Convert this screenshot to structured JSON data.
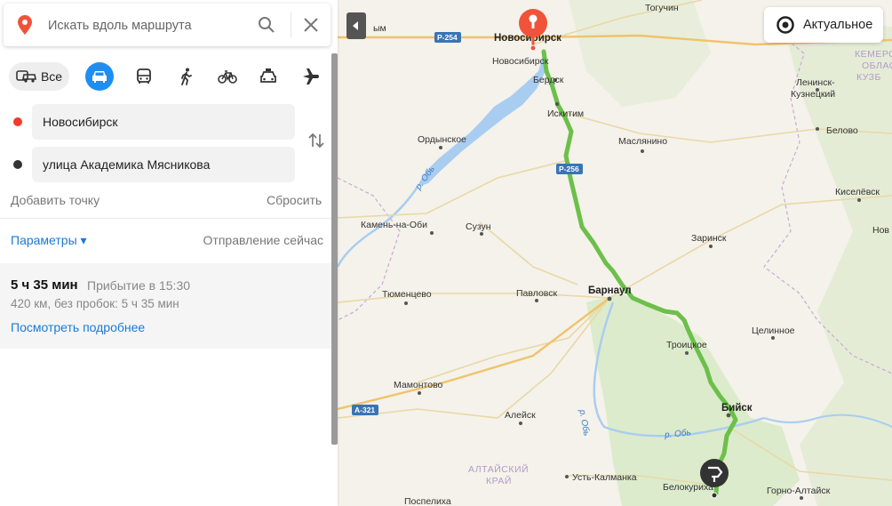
{
  "search": {
    "placeholder": "Искать вдоль маршрута"
  },
  "modes": {
    "all_label": "Все",
    "selected": "car"
  },
  "route_points": {
    "from": "Новосибирск",
    "to": "улица Академика Мясникова"
  },
  "actions": {
    "add_point": "Добавить точку",
    "reset": "Сбросить",
    "params": "Параметры ▾",
    "depart": "Отправление сейчас"
  },
  "route": {
    "duration": "5 ч 35 мин",
    "arrival": "Прибытие в 15:30",
    "distance": "420 км, без пробок: 5 ч 35 мин",
    "details_link": "Посмотреть подробнее"
  },
  "map": {
    "actual_button": "Актуальное",
    "start_city_marker": "Новосибирск",
    "cities": {
      "novosibirsk": "Новосибирск",
      "tyumentsevo_gap": "ым",
      "toguchin": "Тогучин",
      "berdsk": "Бердск",
      "iskitim": "Искитим",
      "ordynskoe": "Ордынское",
      "maslyanino": "Маслянино",
      "leninsk": "Ленинск-\nКузнецкий",
      "belovo": "Белово",
      "kiselevsk": "Киселёвск",
      "kamen": "Камень-на-Оби",
      "suzun": "Сузун",
      "zarinsk": "Заринск",
      "tyumentsevo": "Тюменцево",
      "pavlovsk": "Павловск",
      "barnaul": "Барнаул",
      "tselinnoe": "Целинное",
      "troitskoe": "Троицкое",
      "mamontovo": "Мамонтово",
      "aleysk": "Алейск",
      "biysk": "Бийск",
      "ust_kalmanka": "Усть-Калманка",
      "belokurikha": "Белокуриха",
      "gorno_altaysk": "Горно-Алтайск",
      "pospelikha": "Поспелиха",
      "novo_edge": "Нов"
    },
    "regions": {
      "kemerovo": "КЕМЕРО\nОБЛАС\nКУЗБ",
      "altai": "АЛТАЙСКИЙ\nКРАЙ"
    },
    "rivers": {
      "ob1": "р. Обь",
      "ob2": "р. Обь",
      "ob3": "р. Обь"
    },
    "roads": {
      "r254": "Р-254",
      "r256": "Р-256",
      "a321": "А-321"
    },
    "colors": {
      "route": "#6cc04a",
      "water": "#a9cdf0",
      "marker": "#f0533a"
    }
  }
}
